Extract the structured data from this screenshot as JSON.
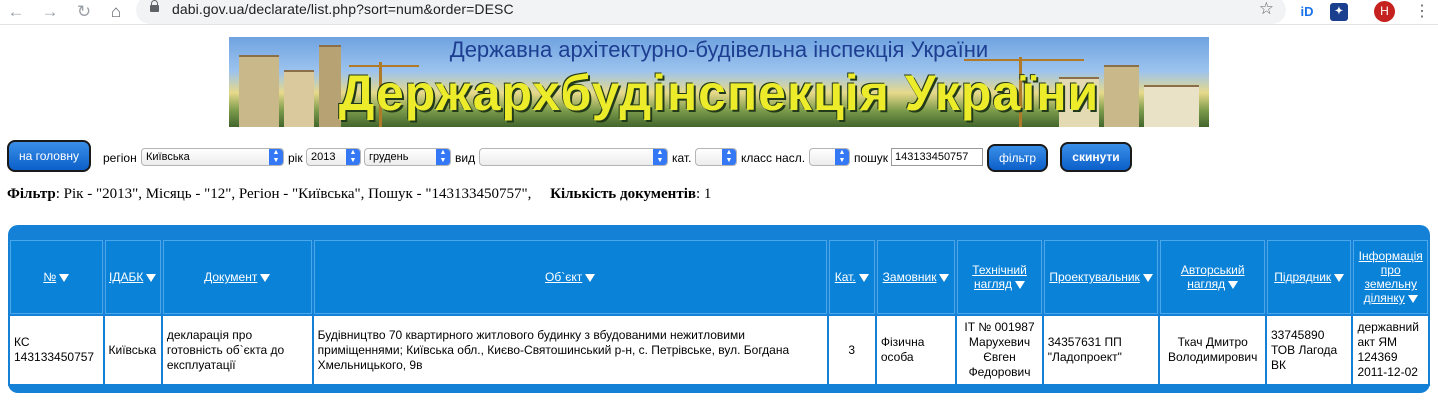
{
  "browser": {
    "url": "dabi.gov.ua/declarate/list.php?sort=num&order=DESC",
    "ext1": "iD",
    "avatar_letter": "H"
  },
  "banner": {
    "subtitle": "Державна архітектурно-будівельна інспекція України",
    "title": "Держархбудінспекція України"
  },
  "filters": {
    "home_button": "на головну",
    "region_label": "регіон",
    "region_value": "Київська",
    "year_label": "рік",
    "year_value": "2013",
    "month_value": "грудень",
    "type_label": "вид",
    "type_value": "",
    "cat_label": "кат.",
    "cat_value": "",
    "class_label": "класс насл.",
    "class_value": "",
    "search_label": "пошук",
    "search_value": "143133450757",
    "filter_button": "фільтр",
    "reset_button": "скинути"
  },
  "summary": {
    "filter_label": "Фільтр",
    "filter_text": ": Рік - \"2013\", Місяць - \"12\", Регіон - \"Київська\", Пошук - \"143133450757\",",
    "count_label": "Кількість документів",
    "count_value": ": 1"
  },
  "table": {
    "headers": [
      "№",
      "ІДАБК",
      "Документ",
      "Об`єкт",
      "Кат.",
      "Замовник",
      "Технічний нагляд",
      "Проектувальник",
      "Авторський нагляд",
      "Підрядник",
      "Інформація про земельну ділянку"
    ],
    "rows": [
      [
        "КС 143133450757",
        "Київська",
        "декларація про готовність об`єкта до експлуатації",
        "Будівництво 70 квартирного житлового будинку з вбудованими нежитловими приміщеннями; Київська обл., Києво-Святошинський р-н, с. Петрівське, вул. Богдана Хмельницького, 9в",
        "3",
        "Фізична особа",
        "ІТ № 001987 Марухевич Євген Федорович",
        "34357631 ПП \"Ладопроект\"",
        "Ткач Дмитро Володимирович",
        "33745890 ТОВ Лагода ВК",
        "державний акт ЯМ 124369 2011-12-02"
      ]
    ]
  }
}
